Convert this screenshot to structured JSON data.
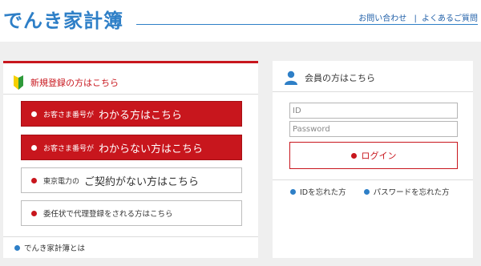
{
  "header": {
    "logo": "でんき家計簿",
    "links": [
      "お問い合わせ",
      "よくあるご質問"
    ],
    "separator": "|"
  },
  "left_panel": {
    "title": "新規登録の方はこちら",
    "buttons": [
      {
        "small": "お客さま番号が",
        "big": "わかる方はこちら"
      },
      {
        "small": "お客さま番号が",
        "big": "わからない方はこちら"
      },
      {
        "small": "東京電力の",
        "big": "ご契約がない方はこちら"
      },
      {
        "only": "委任状で代理登録をされる方はこちら"
      }
    ],
    "about_link": "でんき家計簿とは"
  },
  "right_panel": {
    "title": "会員の方はこちら",
    "id_placeholder": "ID",
    "password_placeholder": "Password",
    "login_label": "ログイン",
    "forgot_id": "IDを忘れた方",
    "forgot_password": "パスワードを忘れた方"
  },
  "colors": {
    "brand_blue": "#2e7fc7",
    "accent_red": "#c8161d",
    "background": "#efefef"
  },
  "icons": [
    "beginner-leaf-icon",
    "user-icon",
    "bullet-dot-icon"
  ]
}
